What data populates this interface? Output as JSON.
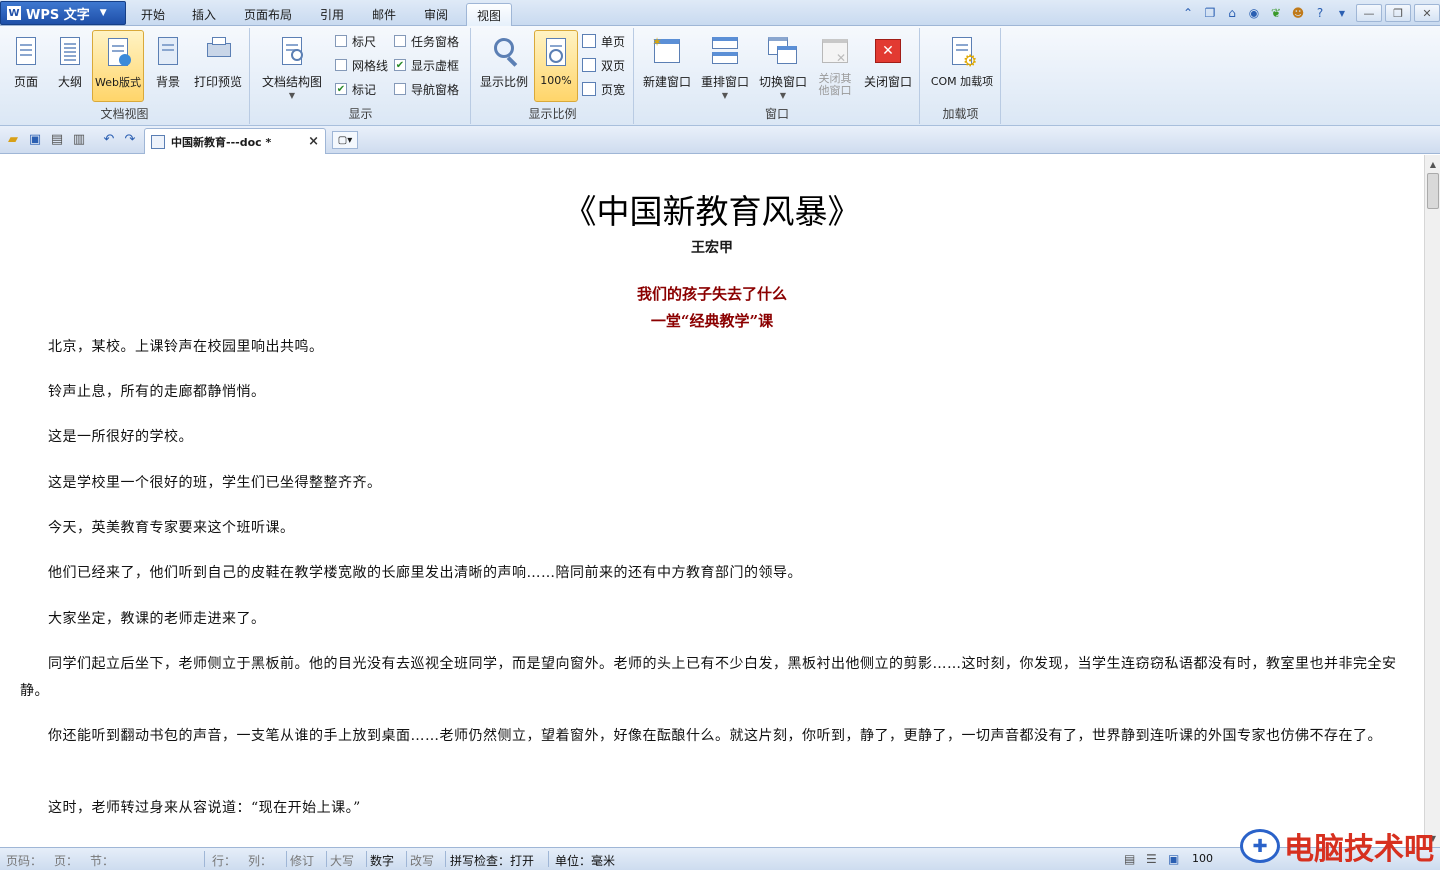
{
  "app": {
    "name": "WPS 文字",
    "logo": "W"
  },
  "menu": {
    "tabs": [
      "开始",
      "插入",
      "页面布局",
      "引用",
      "邮件",
      "审阅",
      "视图"
    ],
    "active": "视图"
  },
  "ribbon": {
    "doc_view": {
      "label": "文档视图",
      "buttons": [
        "页面",
        "大纲",
        "Web版式",
        "背景",
        "打印预览"
      ]
    },
    "show": {
      "label": "显示",
      "doc_struct": "文档结构图",
      "checks": [
        {
          "label": "标尺",
          "checked": false
        },
        {
          "label": "网格线",
          "checked": false
        },
        {
          "label": "标记",
          "checked": true
        },
        {
          "label": "任务窗格",
          "checked": false
        },
        {
          "label": "显示虚框",
          "checked": true
        },
        {
          "label": "导航窗格",
          "checked": false
        }
      ]
    },
    "zoom": {
      "label": "显示比例",
      "zoom_btn": "显示比例",
      "pct_btn": "100%",
      "single": "单页",
      "double": "双页",
      "width": "页宽"
    },
    "window": {
      "label": "窗口",
      "buttons": [
        "新建窗口",
        "重排窗口",
        "切换窗口",
        "关闭其他窗口",
        "关闭窗口"
      ]
    },
    "addins": {
      "label": "加载项",
      "com": "COM 加载项"
    }
  },
  "tabbar": {
    "doc_title": "中国新教育---doc *",
    "close": "×"
  },
  "document": {
    "title": "《中国新教育风暴》",
    "author": "王宏甲",
    "subtitle1": "我们的孩子失去了什么",
    "subtitle2": "一堂“经典教学”课",
    "paragraphs": [
      "北京，某校。上课铃声在校园里响出共鸣。",
      "铃声止息，所有的走廊都静悄悄。",
      "这是一所很好的学校。",
      "这是学校里一个很好的班，学生们已坐得整整齐齐。",
      "今天，英美教育专家要来这个班听课。",
      "他们已经来了，他们听到自己的皮鞋在教学楼宽敞的长廊里发出清晰的声响……陪同前来的还有中方教育部门的领导。",
      "大家坐定，教课的老师走进来了。",
      "同学们起立后坐下，老师侧立于黑板前。他的目光没有去巡视全班同学，而是望向窗外。老师的头上已有不少白发，黑板衬出他侧立的剪影……这时刻，你发现，当学生连窃窃私语都没有时，教室里也并非完全安静。",
      "你还能听到翻动书包的声音，一支笔从谁的手上放到桌面……老师仍然侧立，望着窗外，好像在酝酿什么。就这片刻，你听到，静了，更静了，一切声音都没有了，世界静到连听课的外国专家也仿佛不存在了。",
      "这时，老师转过身来从容说道：“现在开始上课。”"
    ]
  },
  "status": {
    "page": "页码：",
    "pg": "页：",
    "section": "节：",
    "row": "行：",
    "col": "列：",
    "revise": "修订",
    "caps": "大写",
    "num": "数字",
    "overwrite": "改写",
    "spell": "拼写检查：打开",
    "unit": "单位：毫米",
    "zoom": "100"
  },
  "watermark": {
    "text": "电脑技术吧"
  }
}
